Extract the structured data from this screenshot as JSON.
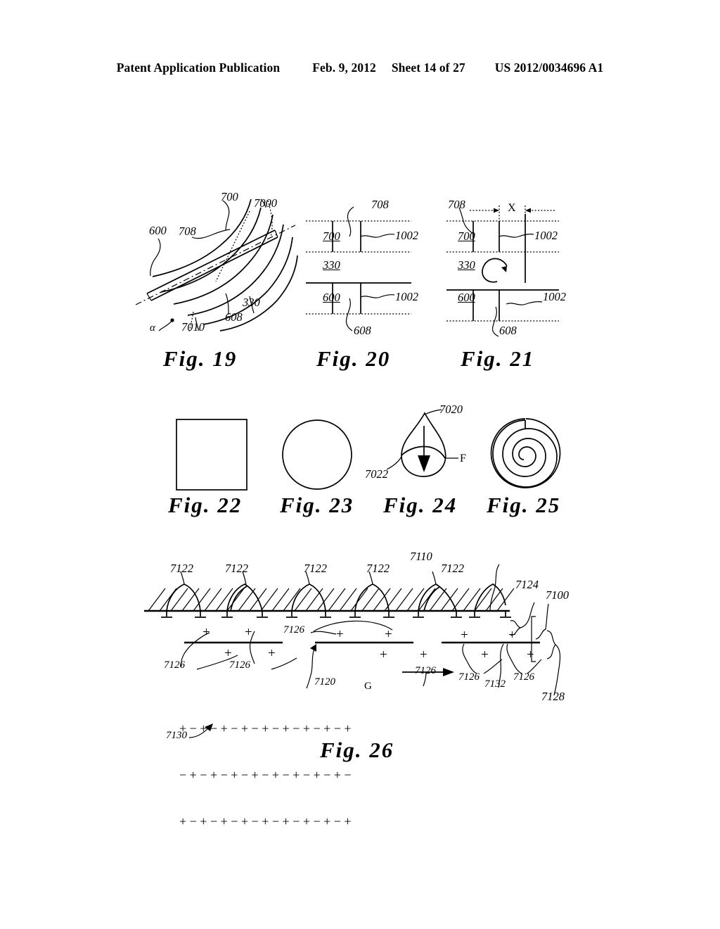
{
  "header": {
    "publication": "Patent Application Publication",
    "date": "Feb. 9, 2012",
    "sheet": "Sheet 14 of 27",
    "number": "US 2012/0034696 A1"
  },
  "figures": [
    {
      "id": "fig19",
      "caption": "Fig.  19",
      "description": "Curved fiber arcs crossed by a diagonal band with angle alpha",
      "labels": [
        "700",
        "7000",
        "600",
        "708",
        "330",
        "608",
        "7010",
        "α"
      ]
    },
    {
      "id": "fig20",
      "caption": "Fig.  20",
      "description": "Two parallel layer bands separated by a gap layer, aligned",
      "labels": [
        "708",
        "700",
        "1002",
        "330",
        "600",
        "1002",
        "608"
      ]
    },
    {
      "id": "fig21",
      "caption": "Fig.  21",
      "description": "Two parallel layer bands offset by distance X with rotation arrow",
      "labels": [
        "708",
        "X",
        "700",
        "1002",
        "330",
        "600",
        "1002",
        "608"
      ]
    },
    {
      "id": "fig22",
      "caption": "Fig.  22",
      "description": "Square cross-section outline",
      "labels": []
    },
    {
      "id": "fig23",
      "caption": "Fig.  23",
      "description": "Circular cross-section outline",
      "labels": []
    },
    {
      "id": "fig24",
      "caption": "Fig.  24",
      "description": "Teardrop cross-section with downward force arrow F",
      "labels": [
        "7020",
        "F",
        "7022"
      ]
    },
    {
      "id": "fig25",
      "caption": "Fig.  25",
      "description": "Spiral rolled cross-section",
      "labels": []
    },
    {
      "id": "fig26",
      "caption": "Fig.  26",
      "description": "Layered electrostatic structure with hatched nap layer, charge plates and charge lattice",
      "labels": [
        "7122",
        "7110",
        "7124",
        "7100",
        "7126",
        "7120",
        "G",
        "7132",
        "7128",
        "7130"
      ]
    }
  ],
  "fig19": {
    "n700": "700",
    "n7000": "7000",
    "n600": "600",
    "n708": "708",
    "n330": "330",
    "n608": "608",
    "n7010": "7010",
    "alpha": "α",
    "caption": "Fig.  19"
  },
  "fig20": {
    "n708": "708",
    "n700": "700",
    "n1002a": "1002",
    "n330": "330",
    "n600": "600",
    "n1002b": "1002",
    "n608": "608",
    "caption": "Fig.  20"
  },
  "fig21": {
    "n708": "708",
    "dim_x": "X",
    "n700": "700",
    "n1002a": "1002",
    "n330": "330",
    "n600": "600",
    "n1002b": "1002",
    "n608": "608",
    "caption": "Fig.  21"
  },
  "fig22": {
    "caption": "Fig.  22"
  },
  "fig23": {
    "caption": "Fig.  23"
  },
  "fig24": {
    "n7020": "7020",
    "force": "F",
    "n7022": "7022",
    "caption": "Fig.  24"
  },
  "fig25": {
    "caption": "Fig.  25"
  },
  "fig26": {
    "caption": "Fig.  26",
    "nap_labels": [
      "7122",
      "7122",
      "7122",
      "7122",
      "7122"
    ],
    "n7110": "7110",
    "n7124": "7124",
    "n7100": "7100",
    "charge_labels": [
      "7126",
      "7126",
      "7126",
      "7126",
      "7126",
      "7126",
      "7126"
    ],
    "n7120": "7120",
    "gravity": "G",
    "n7132": "7132",
    "n7128": "7128",
    "n7130": "7130",
    "plus": "+",
    "minus": "−",
    "lattice": {
      "rows": [
        "+ − + − + − + − + − + − + − + − +",
        "− + − + − + − + − + − + − + − + −",
        "+ − + − + − + − + − + − + − + − +"
      ]
    }
  }
}
